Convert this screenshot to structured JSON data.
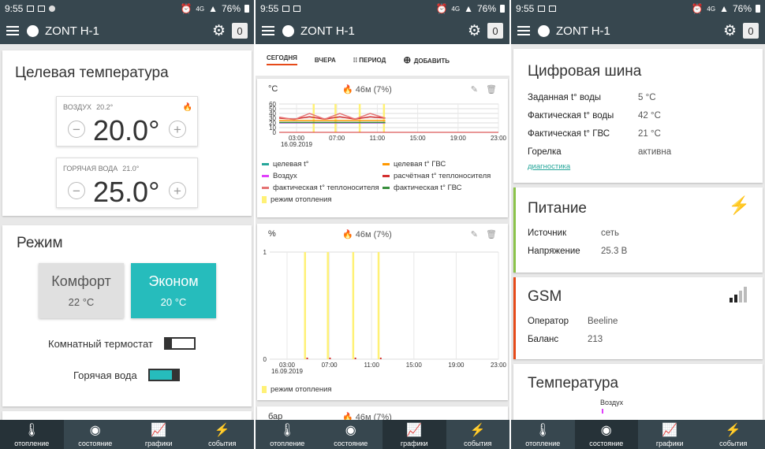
{
  "status": {
    "time": "9:55",
    "net": "4G",
    "battery": "76%"
  },
  "appbar": {
    "title": "ZONT H-1",
    "badge": "0"
  },
  "nav": [
    {
      "label": "отопление",
      "icon": "thermometer-icon"
    },
    {
      "label": "состояние",
      "icon": "circle-icon"
    },
    {
      "label": "графики",
      "icon": "chart-icon"
    },
    {
      "label": "события",
      "icon": "lightning-icon"
    }
  ],
  "heating": {
    "title": "Целевая температура",
    "air": {
      "label": "ВОЗДУХ",
      "current": "20.2°",
      "target": "20.0°"
    },
    "water": {
      "label": "ГОРЯЧАЯ ВОДА",
      "current": "21.0°",
      "target": "25.0°"
    },
    "mode_title": "Режим",
    "modes": [
      {
        "name": "Комфорт",
        "temp": "22 °C"
      },
      {
        "name": "Эконом",
        "temp": "20 °C"
      }
    ],
    "room_thermostat": "Комнатный термостат",
    "hot_water": "Горячая вода",
    "plus": "+",
    "minus": "−"
  },
  "graphs": {
    "tabs": [
      "СЕГОДНЯ",
      "ВЧЕРА",
      "ПЕРИОД",
      "ДОБАВИТЬ"
    ],
    "chart1_unit": "°C",
    "chart1_flame": "46м (7%)",
    "chart2_unit": "%",
    "chart2_flame": "46м (7%)",
    "chart3_unit": "бар",
    "chart3_flame": "46м (7%)",
    "date": "16.09.2019"
  },
  "chart_data": [
    {
      "type": "line",
      "ylabel": "°C",
      "ylim": [
        0,
        60
      ],
      "yticks": [
        0,
        10,
        20,
        30,
        40,
        50,
        60
      ],
      "xticks": [
        "03:00",
        "07:00",
        "11:00",
        "15:00",
        "19:00",
        "23:00"
      ],
      "series": [
        {
          "name": "целевая t°",
          "color": "#26a69a",
          "values": [
            20,
            20,
            20,
            20,
            20,
            20,
            20,
            20
          ]
        },
        {
          "name": "целевая t° ГВС",
          "color": "#ff9800",
          "values": [
            25,
            25,
            25,
            25,
            25,
            25,
            25,
            25
          ]
        },
        {
          "name": "Воздух",
          "color": "#e040fb",
          "values": [
            20.2,
            20.2,
            20.2,
            20.2,
            20.2,
            20.2,
            20.2,
            20.2
          ]
        },
        {
          "name": "расчётная t° теплоносителя",
          "color": "#d32f2f",
          "values": [
            30,
            28,
            33,
            28,
            33,
            28,
            33,
            30
          ]
        },
        {
          "name": "фактическая t° теплоносителя",
          "color": "#e57373",
          "values": [
            32,
            27,
            40,
            28,
            40,
            28,
            40,
            30
          ]
        },
        {
          "name": "фактическая t° ГВС",
          "color": "#388e3c",
          "values": [
            21,
            21,
            21,
            21,
            21,
            21,
            21,
            21
          ]
        }
      ],
      "heating_mode": {
        "name": "режим отопления",
        "color": "#fff176"
      }
    },
    {
      "type": "bar",
      "ylabel": "%",
      "ylim": [
        0,
        1
      ],
      "yticks": [
        0,
        1
      ],
      "xticks": [
        "03:00",
        "07:00",
        "11:00",
        "15:00",
        "19:00",
        "23:00"
      ],
      "series": [
        {
          "name": "режим отопления",
          "color": "#fff176"
        }
      ]
    }
  ],
  "state": {
    "bus": {
      "title": "Цифровая шина",
      "rows": [
        {
          "k": "Заданная t° воды",
          "v": "5 °C"
        },
        {
          "k": "Фактическая t° воды",
          "v": "42 °C"
        },
        {
          "k": "Фактическая t° ГВС",
          "v": "21 °C"
        },
        {
          "k": "Горелка",
          "v": "активна"
        }
      ],
      "link": "диагностика"
    },
    "power": {
      "title": "Питание",
      "rows": [
        {
          "k": "Источник",
          "v": "сеть"
        },
        {
          "k": "Напряжение",
          "v": "25.3 В"
        }
      ],
      "color": "#8bc34a"
    },
    "gsm": {
      "title": "GSM",
      "rows": [
        {
          "k": "Оператор",
          "v": "Beeline"
        },
        {
          "k": "Баланс",
          "v": "213"
        }
      ],
      "color": "#e64a19"
    },
    "temp": {
      "title": "Температура",
      "sub": "Воздух"
    }
  }
}
